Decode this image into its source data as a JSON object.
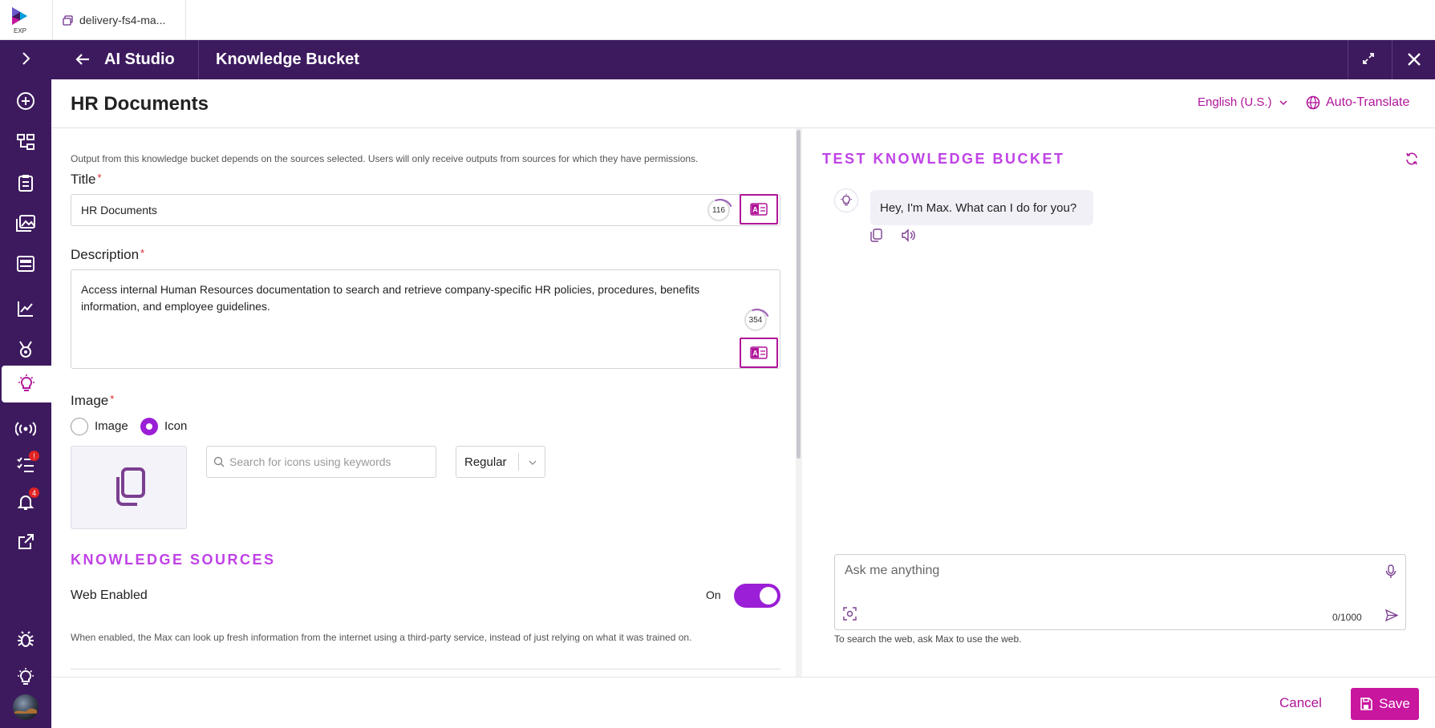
{
  "tab": {
    "label": "delivery-fs4-ma..."
  },
  "logo": {
    "text": "EXP"
  },
  "sidebar": {
    "badges": {
      "tasks": "!",
      "notifications": "4"
    }
  },
  "header": {
    "app_title": "AI Studio",
    "page_title": "Knowledge Bucket"
  },
  "titlebar": {
    "title": "HR Documents",
    "language": "English (U.S.)",
    "auto_translate": "Auto-Translate"
  },
  "form": {
    "hint": "Output from this knowledge bucket depends on the sources selected. Users will only receive outputs from sources for which they have permissions.",
    "title_label": "Title",
    "title_value": "HR Documents",
    "title_counter": "116",
    "description_label": "Description",
    "description_value": "Access internal Human Resources documentation to search and retrieve company-specific HR policies, procedures, benefits information, and employee guidelines.",
    "description_counter": "354",
    "image_label": "Image",
    "radio_image": "Image",
    "radio_icon": "Icon",
    "icon_search_placeholder": "Search for icons using keywords",
    "icon_style": "Regular",
    "required_mark": "*"
  },
  "knowledge_sources": {
    "heading": "KNOWLEDGE SOURCES",
    "web_enabled_label": "Web Enabled",
    "web_enabled_state": "On",
    "web_enabled_hint": "When enabled, the Max can look up fresh information from the internet using a third-party service, instead of just relying on what it was trained on."
  },
  "test_panel": {
    "heading": "TEST KNOWLEDGE BUCKET",
    "greeting": "Hey, I'm Max. What can I do for you?",
    "input_placeholder": "Ask me anything",
    "char_count": "0/1000",
    "web_hint": "To search the web, ask Max to use the web."
  },
  "footer": {
    "cancel": "Cancel",
    "save": "Save"
  },
  "colors": {
    "primary_dark": "#3d1a5e",
    "accent": "#b0159a",
    "accent_purple": "#9b1fd6",
    "section_heading": "#c042e6"
  }
}
